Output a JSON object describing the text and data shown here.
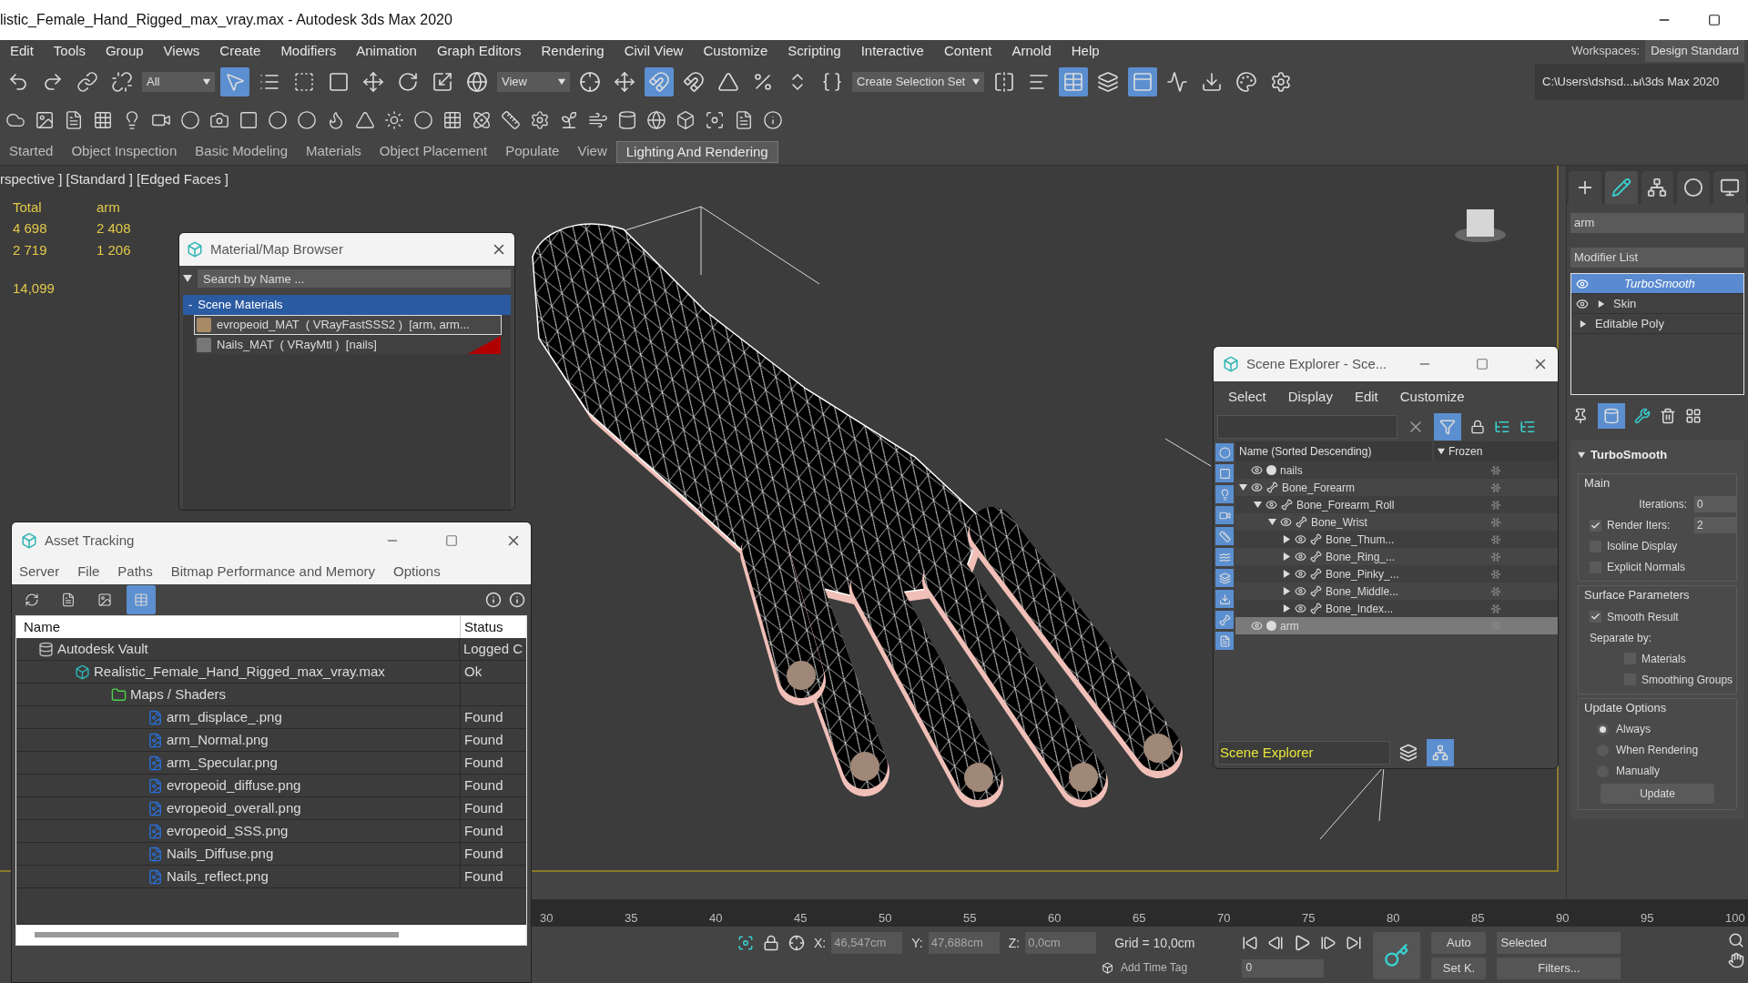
{
  "window": {
    "title": "listic_Female_Hand_Rigged_max_vray.max - Autodesk 3ds Max 2020"
  },
  "menu": [
    "Edit",
    "Tools",
    "Group",
    "Views",
    "Create",
    "Modifiers",
    "Animation",
    "Graph Editors",
    "Rendering",
    "Civil View",
    "Customize",
    "Scripting",
    "Interactive",
    "Content",
    "Arnold",
    "Help"
  ],
  "workspaces": {
    "label": "Workspaces:",
    "value": "Design Standard"
  },
  "main_toolbar": [
    {
      "kind": "button",
      "selected": false
    },
    {
      "kind": "button",
      "selected": false
    },
    {
      "kind": "button",
      "selected": false
    },
    {
      "kind": "button",
      "selected": false
    },
    {
      "kind": "dropdown",
      "value": "All"
    },
    {
      "kind": "button",
      "selected": true
    },
    {
      "kind": "button",
      "selected": false
    },
    {
      "kind": "button",
      "selected": false
    },
    {
      "kind": "button",
      "selected": false
    },
    {
      "kind": "button",
      "selected": false
    },
    {
      "kind": "button",
      "selected": false
    },
    {
      "kind": "button",
      "selected": false
    },
    {
      "kind": "button",
      "selected": false
    },
    {
      "kind": "dropdown",
      "value": "View"
    },
    {
      "kind": "button",
      "selected": false
    },
    {
      "kind": "button",
      "selected": false
    },
    {
      "kind": "button",
      "selected": true
    },
    {
      "kind": "button",
      "selected": false
    },
    {
      "kind": "button",
      "selected": false
    },
    {
      "kind": "button",
      "selected": false
    },
    {
      "kind": "button",
      "selected": false
    },
    {
      "kind": "button",
      "selected": false
    },
    {
      "kind": "dropdown",
      "value": "Create Selection Set"
    },
    {
      "kind": "button",
      "selected": false
    },
    {
      "kind": "button",
      "selected": false
    },
    {
      "kind": "button",
      "selected": true
    },
    {
      "kind": "button",
      "selected": false
    },
    {
      "kind": "button",
      "selected": true
    },
    {
      "kind": "button",
      "selected": false
    },
    {
      "kind": "button",
      "selected": false
    },
    {
      "kind": "button",
      "selected": false
    },
    {
      "kind": "button",
      "selected": false
    },
    {
      "kind": "path",
      "value": "C:\\Users\\dshsd...ы\\3ds Max 2020"
    }
  ],
  "ribbon_tabs": [
    {
      "label": "Started",
      "selected": false
    },
    {
      "label": "Object Inspection",
      "selected": false
    },
    {
      "label": "Basic Modeling",
      "selected": false
    },
    {
      "label": "Materials",
      "selected": false
    },
    {
      "label": "Object Placement",
      "selected": false
    },
    {
      "label": "Populate",
      "selected": false
    },
    {
      "label": "View",
      "selected": false
    },
    {
      "label": "Lighting And Rendering",
      "selected": true
    }
  ],
  "viewport": {
    "label": "rspective ] [Standard ] [Edged Faces ]",
    "stats": [
      [
        "Total",
        "arm"
      ],
      [
        "4 698",
        "2 408"
      ],
      [
        "2 719",
        "1 206"
      ]
    ],
    "fps": "14,099"
  },
  "material_browser": {
    "title": "Material/Map Browser",
    "search": {
      "placeholder": "Search by Name ..."
    },
    "group": {
      "toggle": "-",
      "label": "Scene Materials"
    },
    "materials": [
      {
        "name": "evropeoid_MAT  ( VRayFastSSS2 )  [arm, arm...",
        "selected": true,
        "flagged": false
      },
      {
        "name": "Nails_MAT  ( VRayMtl )  [nails]",
        "selected": false,
        "flagged": true
      }
    ]
  },
  "asset_tracking": {
    "title": "Asset Tracking",
    "menu": [
      "Server",
      "File",
      "Paths",
      "Bitmap Performance and Memory",
      "Options"
    ],
    "view_buttons": [
      {
        "selected": false
      },
      {
        "selected": false
      },
      {
        "selected": false
      },
      {
        "selected": true
      }
    ],
    "columns": [
      "Name",
      "Status"
    ],
    "rows": [
      {
        "kind": "vault",
        "name": "Autodesk Vault",
        "status": "Logged C",
        "children": [
          {
            "kind": "scene",
            "name": "Realistic_Female_Hand_Rigged_max_vray.max",
            "status": "Ok",
            "children": [
              {
                "kind": "folder",
                "name": "Maps / Shaders",
                "children": [
                  {
                    "kind": "bitmap",
                    "name": "arm_displace_.png",
                    "status": "Found"
                  },
                  {
                    "kind": "bitmap",
                    "name": "arm_Normal.png",
                    "status": "Found"
                  },
                  {
                    "kind": "bitmap",
                    "name": "arm_Specular.png",
                    "status": "Found"
                  },
                  {
                    "kind": "bitmap",
                    "name": "evropeoid_diffuse.png",
                    "status": "Found"
                  },
                  {
                    "kind": "bitmap",
                    "name": "evropeoid_overall.png",
                    "status": "Found"
                  },
                  {
                    "kind": "bitmap",
                    "name": "evropeoid_SSS.png",
                    "status": "Found"
                  },
                  {
                    "kind": "bitmap",
                    "name": "Nails_Diffuse.png",
                    "status": "Found"
                  },
                  {
                    "kind": "bitmap",
                    "name": "Nails_reflect.png",
                    "status": "Found"
                  }
                ]
              }
            ]
          }
        ]
      }
    ]
  },
  "scene_explorer": {
    "title": "Scene Explorer - Sce...",
    "menu": [
      "Select",
      "Display",
      "Edit",
      "Customize"
    ],
    "filter_on": true,
    "columns": [
      "Name (Sorted Descending)",
      "Frozen"
    ],
    "tree": [
      {
        "kind": "geometry",
        "name": "nails",
        "selected": false
      },
      {
        "kind": "bone",
        "name": "Bone_Forearm",
        "selected": false,
        "expanded": true,
        "children": [
          {
            "kind": "bone",
            "name": "Bone_Forearm_Roll",
            "selected": false,
            "expanded": true,
            "children": [
              {
                "kind": "bone",
                "name": "Bone_Wrist",
                "selected": false,
                "expanded": true,
                "children": [
                  {
                    "kind": "bone",
                    "name": "Bone_Thum...",
                    "selected": false,
                    "expanded": false
                  },
                  {
                    "kind": "bone",
                    "name": "Bone_Ring_...",
                    "selected": false,
                    "expanded": false
                  },
                  {
                    "kind": "bone",
                    "name": "Bone_Pinky_...",
                    "selected": false,
                    "expanded": false
                  },
                  {
                    "kind": "bone",
                    "name": "Bone_Middle...",
                    "selected": false,
                    "expanded": false
                  },
                  {
                    "kind": "bone",
                    "name": "Bone_Index...",
                    "selected": false,
                    "expanded": false
                  }
                ]
              }
            ]
          }
        ]
      },
      {
        "kind": "geometry",
        "name": "arm",
        "selected": true
      }
    ],
    "footer": "Scene Explorer",
    "hierarchy_mode": true
  },
  "command_panel": {
    "tabs": [
      {
        "selected": false
      },
      {
        "selected": true
      },
      {
        "selected": false
      },
      {
        "selected": false
      },
      {
        "selected": false
      }
    ],
    "object_name": "arm",
    "modifier_list": "Modifier List",
    "modifiers": [
      {
        "kind": "modifier",
        "name": "TurboSmooth",
        "selected": true
      },
      {
        "kind": "modifier",
        "name": "Skin",
        "selected": false,
        "expanded": false
      },
      {
        "kind": "base",
        "name": "Editable Poly",
        "selected": false,
        "expanded": false
      }
    ],
    "rollout": {
      "title": "TurboSmooth",
      "expanded": true,
      "groups": [
        {
          "title": "Main",
          "controls": [
            {
              "kind": "spinner",
              "label": "Iterations:",
              "value": "0"
            },
            {
              "kind": "check_spinner",
              "label": "Render Iters:",
              "checked": true,
              "value": "2"
            },
            {
              "kind": "checkbox",
              "label": "Isoline Display",
              "checked": false
            },
            {
              "kind": "checkbox",
              "label": "Explicit Normals",
              "checked": false
            }
          ]
        },
        {
          "title": "Surface Parameters",
          "controls": [
            {
              "kind": "checkbox",
              "label": "Smooth Result",
              "checked": true
            },
            {
              "kind": "label",
              "label": "Separate by:"
            },
            {
              "kind": "sub_checkbox",
              "label": "Materials",
              "checked": false
            },
            {
              "kind": "sub_checkbox",
              "label": "Smoothing Groups",
              "checked": false
            }
          ]
        },
        {
          "title": "Update Options",
          "controls": [
            {
              "kind": "radio",
              "label": "Always",
              "selected": true
            },
            {
              "kind": "radio",
              "label": "When Rendering",
              "selected": false
            },
            {
              "kind": "radio",
              "label": "Manually",
              "selected": false
            },
            {
              "kind": "button",
              "label": "Update"
            }
          ]
        }
      ]
    }
  },
  "timeline": {
    "ticks": [
      "30",
      "35",
      "40",
      "45",
      "50",
      "55",
      "60",
      "65",
      "70",
      "75",
      "80",
      "85",
      "90",
      "95",
      "100"
    ]
  },
  "status_bar": {
    "x": {
      "label": "X:",
      "value": "46,547cm"
    },
    "y": {
      "label": "Y:",
      "value": "47,688cm"
    },
    "z": {
      "label": "Z:",
      "value": "0,0cm"
    },
    "grid": "Grid = 10,0cm",
    "auto_key": "Auto",
    "key_filter": "Selected",
    "set_key": "Set K.",
    "filters": "Filters...",
    "time_tag": "Add Time Tag",
    "frame": "0"
  }
}
